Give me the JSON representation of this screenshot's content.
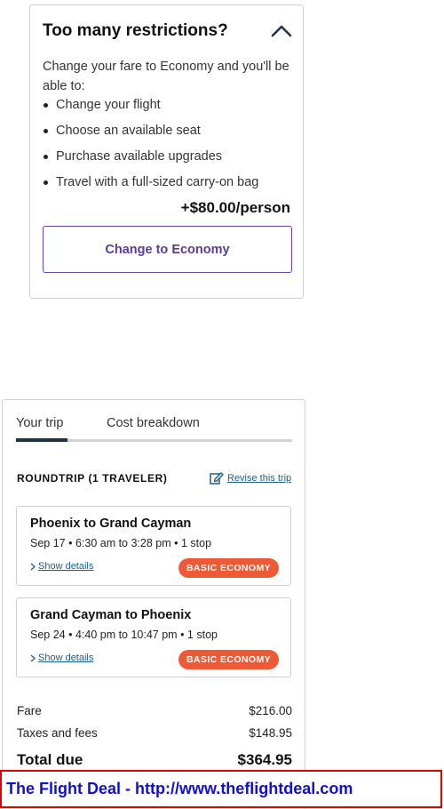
{
  "restrictions": {
    "title": "Too many restrictions?",
    "toggle_icon": "chevron-up-icon",
    "intro": "Change your fare to Economy and you'll be able to:",
    "benefits": [
      "Change your flight",
      "Choose an available seat",
      "Purchase available upgrades",
      "Travel with a full-sized carry-on bag"
    ],
    "price": "+$80.00/person",
    "button_label": "Change to Economy"
  },
  "trip": {
    "tabs": [
      "Your trip",
      "Cost breakdown"
    ],
    "active_tab": "Your trip",
    "heading": "ROUNDTRIP (1 TRAVELER)",
    "revise_label": "Revise this trip",
    "flights": [
      {
        "route": "Phoenix to Grand Cayman",
        "time": "Sep 17 • 6:30 am to 3:28 pm • 1 stop",
        "details_label": "Show details",
        "badge": "BASIC ECONOMY"
      },
      {
        "route": "Grand Cayman to Phoenix",
        "time": "Sep 24 • 4:40 pm to 10:47 pm • 1 stop",
        "details_label": "Show details",
        "badge": "BASIC ECONOMY"
      }
    ],
    "costs": {
      "fare_label": "Fare",
      "fare_value": "$216.00",
      "taxes_label": "Taxes and fees",
      "taxes_value": "$148.95",
      "total_label": "Total due",
      "total_value": "$364.95"
    }
  },
  "banner": {
    "text": "The Flight Deal - http://www.theflightdeal.com"
  },
  "colors": {
    "accent_purple": "#5b3b95",
    "badge_orange": "#ee5a35",
    "link_blue": "#1a5f8a",
    "tab_active": "#1f3346",
    "banner_text": "#1010d0",
    "banner_border": "#e00000"
  }
}
